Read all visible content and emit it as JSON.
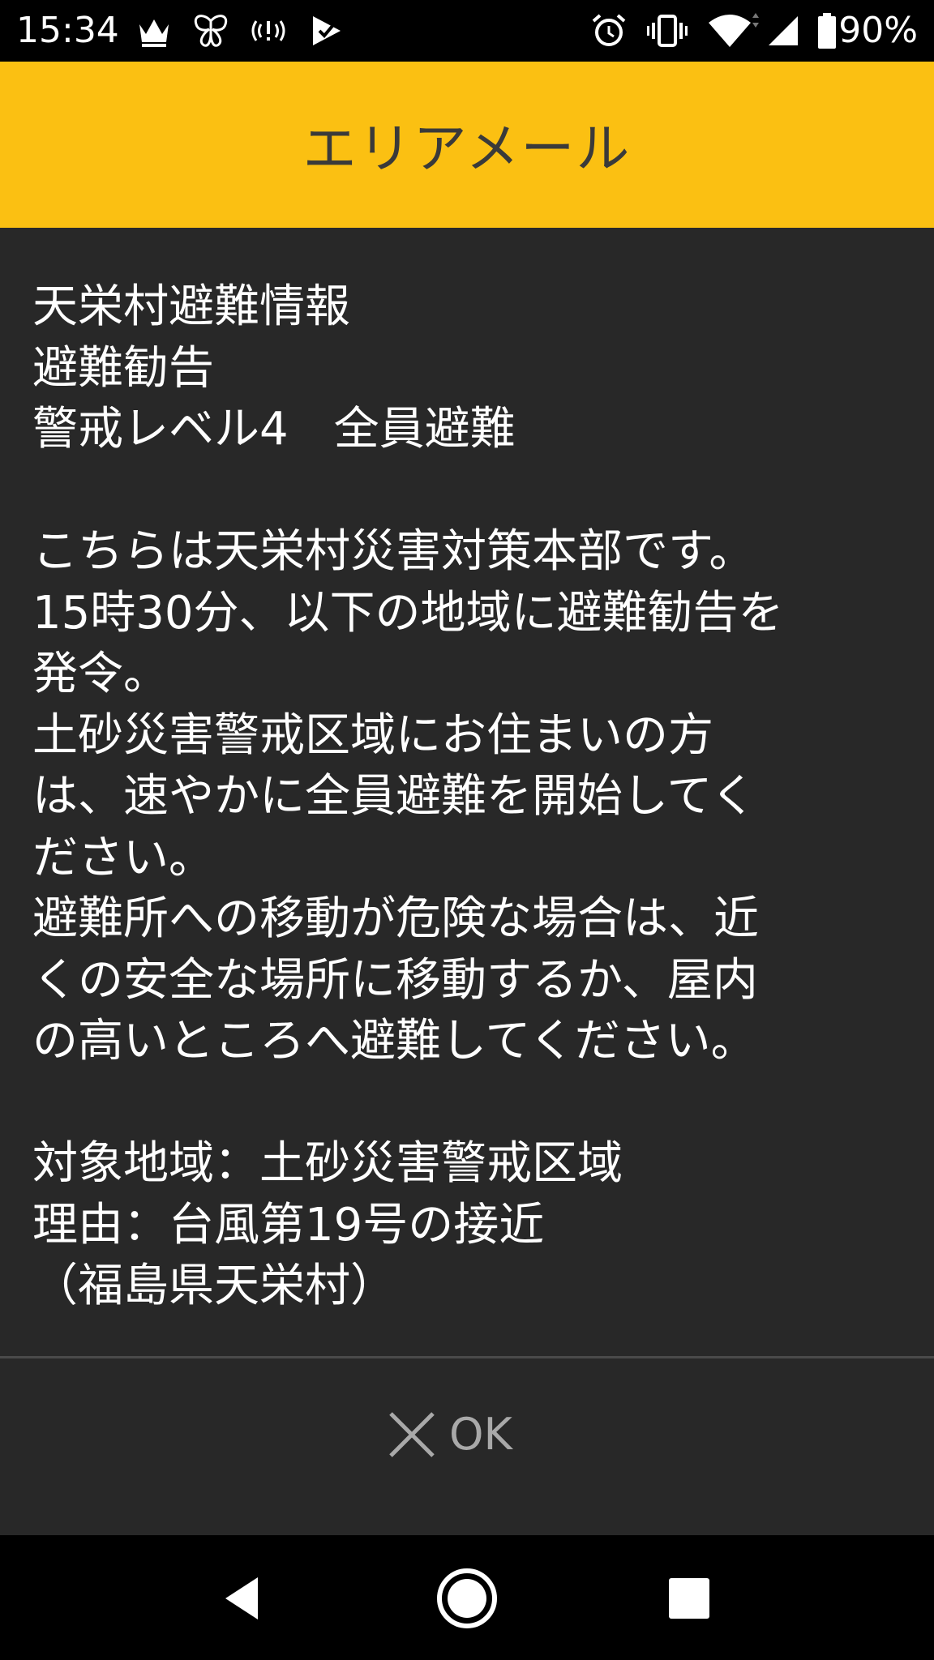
{
  "status_bar": {
    "time": "15:34",
    "battery_percent": "90%",
    "icons_left": [
      "crown-icon",
      "butterfly-icon",
      "vibrate-alert-icon",
      "play-check-icon"
    ],
    "icons_right": [
      "alarm-icon",
      "vibrate-icon",
      "wifi-icon",
      "signal-icon",
      "battery-icon"
    ]
  },
  "title_bar": {
    "title": "エリアメール",
    "background_color": "#fbc012"
  },
  "message": {
    "lines": [
      "天栄村避難情報",
      "避難勧告",
      "警戒レベル4　全員避難",
      "",
      "こちらは天栄村災害対策本部です。",
      "15時30分、以下の地域に避難勧告を",
      "発令。",
      "土砂災害警戒区域にお住まいの方",
      "は、速やかに全員避難を開始してく",
      "ださい。",
      "避難所への移動が危険な場合は、近",
      "くの安全な場所に移動するか、屋内",
      "の高いところへ避難してください。",
      "",
      "対象地域：土砂災害警戒区域",
      "理由：台風第19号の接近",
      "（福島県天栄村）"
    ]
  },
  "actions": {
    "ok_label": "OK",
    "ok_icon": "close-x-icon"
  },
  "nav_bar": {
    "buttons": [
      "back-icon",
      "home-icon",
      "recents-icon"
    ]
  }
}
